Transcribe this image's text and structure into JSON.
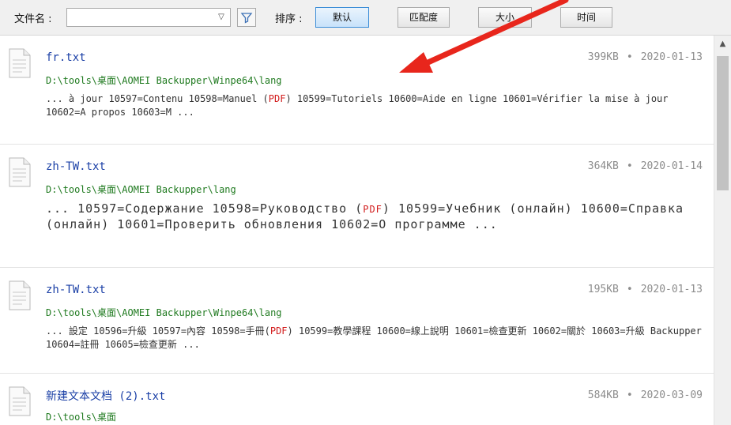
{
  "toolbar": {
    "filename_label": "文件名 :",
    "filename_value": "",
    "sort_label": "排序 :",
    "sort_buttons": [
      {
        "label": "默认",
        "active": true
      },
      {
        "label": "匹配度",
        "active": false
      },
      {
        "label": "大小",
        "active": false
      },
      {
        "label": "时间",
        "active": false
      }
    ]
  },
  "results": [
    {
      "name": "fr.txt",
      "size": "399KB",
      "sep": "•",
      "date": "2020-01-13",
      "path": "D:\\tools\\桌面\\AOMEI Backupper\\Winpe64\\lang",
      "snippet_pre": "... à jour 10597=Contenu 10598=Manuel (",
      "snippet_hl": "PDF",
      "snippet_post": ") 10599=Tutoriels 10600=Aide en ligne 10601=Vérifier la mise à jour 10602=A propos 10603=M ..."
    },
    {
      "name": "zh-TW.txt",
      "size": "364KB",
      "sep": "•",
      "date": "2020-01-14",
      "path": "D:\\tools\\桌面\\AOMEI Backupper\\lang",
      "snippet_pre": "... 10597=Содержание 10598=Руководство (",
      "snippet_hl": "PDF",
      "snippet_post": ") 10599=Учебник (онлайн) 10600=Справка (онлайн) 10601=Проверить обновления 10602=О программе ..."
    },
    {
      "name": "zh-TW.txt",
      "size": "195KB",
      "sep": "•",
      "date": "2020-01-13",
      "path": "D:\\tools\\桌面\\AOMEI Backupper\\Winpe64\\lang",
      "snippet_pre": "... 設定 10596=升級 10597=內容 10598=手冊(",
      "snippet_hl": "PDF",
      "snippet_post": ") 10599=教學課程 10600=線上說明 10601=檢查更新 10602=關於 10603=升級 Backupper 10604=註冊 10605=檢查更新 ..."
    },
    {
      "name": "新建文本文档 (2).txt",
      "size": "584KB",
      "sep": "•",
      "date": "2020-03-09",
      "path": "D:\\tools\\桌面"
    }
  ],
  "icons": {
    "filter": "filter-icon",
    "file": "text-file-icon",
    "dropdown": "chevron-down-icon",
    "scroll_up": "chevron-up-icon"
  },
  "colors": {
    "filename": "#1a3fa6",
    "path": "#1f7a1f",
    "highlight": "#d21c1c",
    "annotation_arrow": "#e8261c"
  }
}
